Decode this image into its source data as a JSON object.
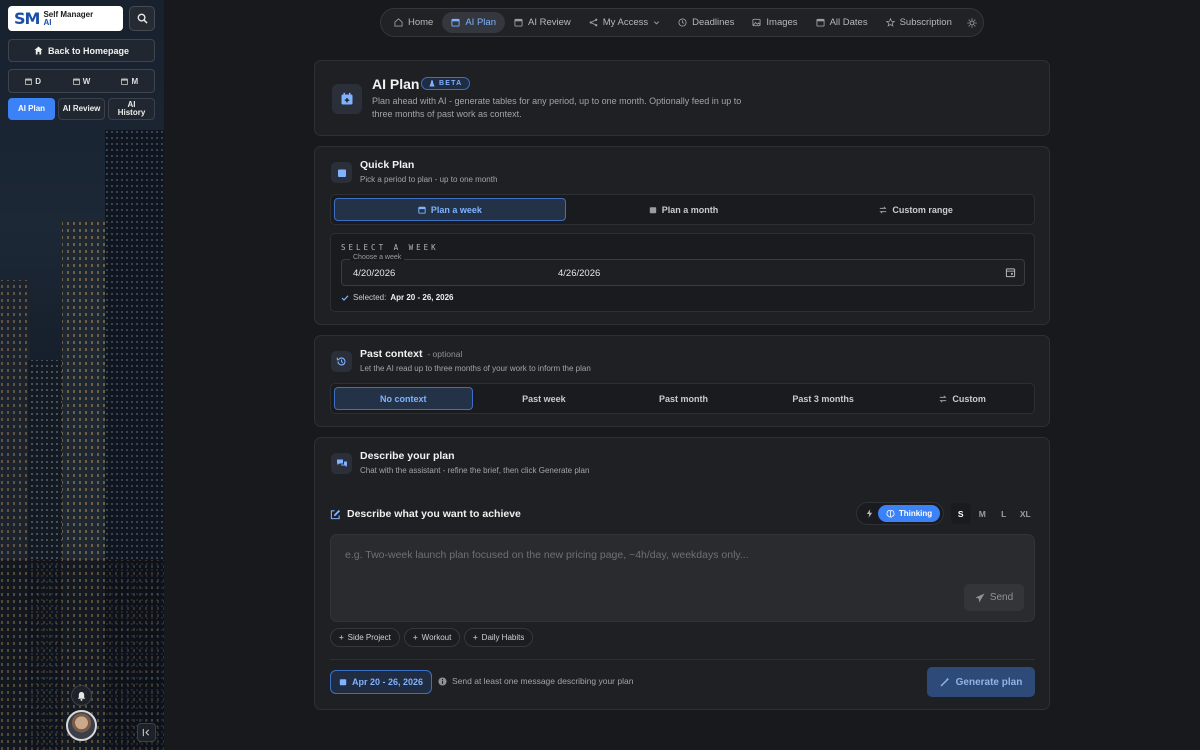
{
  "sidebar": {
    "logo": {
      "mark": "SM",
      "line1": "Self Manager",
      "line2": "AI"
    },
    "back_label": "Back to Homepage",
    "view_toggle": [
      "D",
      "W",
      "M"
    ],
    "ai_tabs": [
      {
        "label": "AI Plan",
        "active": true
      },
      {
        "label": "AI Review",
        "active": false
      },
      {
        "label": "AI History",
        "active": false
      }
    ]
  },
  "topnav": {
    "items": [
      {
        "label": "Home",
        "icon": "home-icon"
      },
      {
        "label": "AI Plan",
        "icon": "calendar-icon",
        "active": true
      },
      {
        "label": "AI Review",
        "icon": "calendar-icon"
      },
      {
        "label": "My Access",
        "icon": "share-icon"
      },
      {
        "label": "Deadlines",
        "icon": "clock-icon"
      },
      {
        "label": "Images",
        "icon": "image-icon"
      },
      {
        "label": "All Dates",
        "icon": "calendar-icon"
      },
      {
        "label": "Subscription",
        "icon": "star-icon"
      }
    ]
  },
  "header": {
    "title": "AI Plan",
    "badge": "BETA",
    "desc_line1": "Plan ahead with AI - generate tables for any period, up to one month. Optionally feed in up to",
    "desc_line2": "three months of past work as context."
  },
  "quick_plan": {
    "title": "Quick Plan",
    "subtitle": "Pick a period to plan - up to one month",
    "options": [
      {
        "label": "Plan a week",
        "active": true
      },
      {
        "label": "Plan a month",
        "active": false
      },
      {
        "label": "Custom range",
        "active": false
      }
    ],
    "select_label": "SELECT A WEEK",
    "field_label": "Choose a week",
    "start_date": "4/20/2026",
    "end_date": "4/26/2026",
    "selected_prefix": "Selected:",
    "selected_value": "Apr 20 - 26, 2026"
  },
  "past_context": {
    "title": "Past context",
    "optional": "- optional",
    "subtitle": "Let the AI read up to three months of your work to inform the plan",
    "options": [
      {
        "label": "No context",
        "active": true
      },
      {
        "label": "Past week",
        "active": false
      },
      {
        "label": "Past month",
        "active": false
      },
      {
        "label": "Past 3 months",
        "active": false
      },
      {
        "label": "Custom",
        "active": false
      }
    ]
  },
  "describe": {
    "title": "Describe your plan",
    "subtitle": "Chat with the assistant - refine the brief, then click Generate plan",
    "prompt_heading": "Describe what you want to achieve",
    "mode_label": "Thinking",
    "sizes": [
      "S",
      "M",
      "L",
      "XL"
    ],
    "active_size": "S",
    "placeholder": "e.g. Two-week launch plan focused on the new pricing page, ~4h/day, weekdays only...",
    "send_label": "Send",
    "chips": [
      "Side Project",
      "Workout",
      "Daily Habits"
    ],
    "footer_date": "Apr 20 - 26, 2026",
    "footer_hint": "Send at least one message describing your plan",
    "generate_label": "Generate plan"
  },
  "colors": {
    "accent": "#3b82f6",
    "accent_text": "#7fb2ff",
    "card_bg": "#1f2023",
    "page_bg": "#18191c"
  }
}
